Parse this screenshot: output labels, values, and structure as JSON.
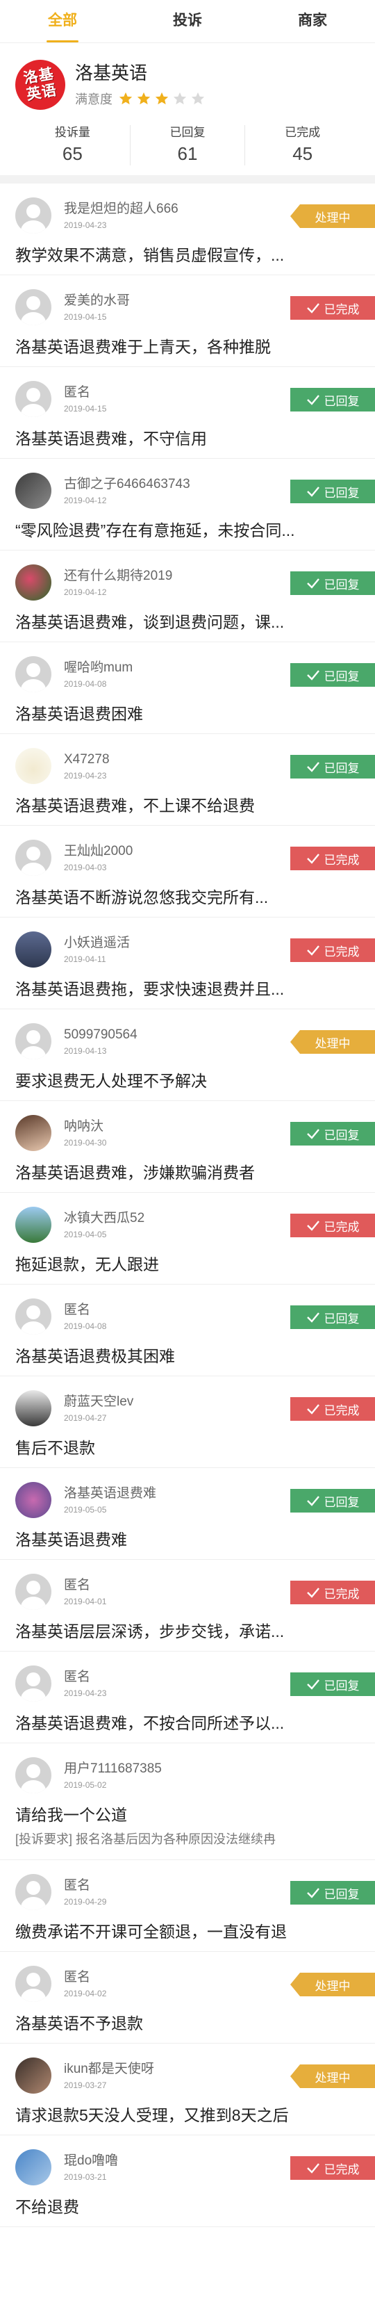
{
  "tabs": [
    {
      "label": "全部"
    },
    {
      "label": "投诉"
    },
    {
      "label": "商家"
    }
  ],
  "company": {
    "logo_line1": "洛基",
    "logo_line2": "英语",
    "name": "洛基英语",
    "rating_label": "满意度",
    "rating_value": 3,
    "rating_max": 5,
    "stats": [
      {
        "label": "投诉量",
        "value": "65"
      },
      {
        "label": "已回复",
        "value": "61"
      },
      {
        "label": "已完成",
        "value": "45"
      }
    ]
  },
  "colors": {
    "accent": "#f0b01c",
    "processing": "#e6ae3c",
    "done": "#e05a5a",
    "replied": "#4aa86a"
  },
  "complaints": [
    {
      "user": "我是炟炟的超人666",
      "date": "2019-04-23",
      "status": "处理中",
      "status_type": "processing",
      "title": "教学效果不满意，销售员虚假宣传，...",
      "avatar": "default"
    },
    {
      "user": "爱美的水哥",
      "date": "2019-04-15",
      "status": "已完成",
      "status_type": "done",
      "title": "洛基英语退费难于上青天，各种推脱",
      "avatar": "default"
    },
    {
      "user": "匿名",
      "date": "2019-04-15",
      "status": "已回复",
      "status_type": "replied",
      "title": "洛基英语退费难，不守信用",
      "avatar": "default"
    },
    {
      "user": "古御之子6466463743",
      "date": "2019-04-12",
      "status": "已回复",
      "status_type": "replied",
      "title": "“零风险退费”存在有意拖延，未按合同...",
      "avatar": "photo-a"
    },
    {
      "user": "还有什么期待2019",
      "date": "2019-04-12",
      "status": "已回复",
      "status_type": "replied",
      "title": "洛基英语退费难，谈到退费问题，课...",
      "avatar": "photo-b"
    },
    {
      "user": "喔哈哟mum",
      "date": "2019-04-08",
      "status": "已回复",
      "status_type": "replied",
      "title": "洛基英语退费困难",
      "avatar": "default"
    },
    {
      "user": "X47278",
      "date": "2019-04-23",
      "status": "已回复",
      "status_type": "replied",
      "title": "洛基英语退费难，不上课不给退费",
      "avatar": "photo-c"
    },
    {
      "user": "王灿灿2000",
      "date": "2019-04-03",
      "status": "已完成",
      "status_type": "done",
      "title": "洛基英语不断游说忽悠我交完所有...",
      "avatar": "default"
    },
    {
      "user": "小妖逍遥活",
      "date": "2019-04-11",
      "status": "已完成",
      "status_type": "done",
      "title": "洛基英语退费拖，要求快速退费并且...",
      "avatar": "photo-d"
    },
    {
      "user": "5099790564",
      "date": "2019-04-13",
      "status": "处理中",
      "status_type": "processing",
      "title": "要求退费无人处理不予解决",
      "avatar": "default"
    },
    {
      "user": "呐呐汏",
      "date": "2019-04-30",
      "status": "已回复",
      "status_type": "replied",
      "title": "洛基英语退费难，涉嫌欺骗消费者",
      "avatar": "photo-e"
    },
    {
      "user": "冰镇大西瓜52",
      "date": "2019-04-05",
      "status": "已完成",
      "status_type": "done",
      "title": "拖延退款，无人跟进",
      "avatar": "photo-f"
    },
    {
      "user": "匿名",
      "date": "2019-04-08",
      "status": "已回复",
      "status_type": "replied",
      "title": "洛基英语退费极其困难",
      "avatar": "default"
    },
    {
      "user": "蔚蓝天空lev",
      "date": "2019-04-27",
      "status": "已完成",
      "status_type": "done",
      "title": "售后不退款",
      "avatar": "photo-g"
    },
    {
      "user": "洛基英语退费难",
      "date": "2019-05-05",
      "status": "已回复",
      "status_type": "replied",
      "title": "洛基英语退费难",
      "avatar": "photo-h"
    },
    {
      "user": "匿名",
      "date": "2019-04-01",
      "status": "已完成",
      "status_type": "done",
      "title": "洛基英语层层深诱，步步交钱，承诺...",
      "avatar": "default"
    },
    {
      "user": "匿名",
      "date": "2019-04-23",
      "status": "已回复",
      "status_type": "replied",
      "title": "洛基英语退费难，不按合同所述予以...",
      "avatar": "default"
    },
    {
      "user": "用户7111687385",
      "date": "2019-05-02",
      "status": "",
      "status_type": "none",
      "title": "请给我一个公道",
      "sub": "[投诉要求] 报名洛基后因为各种原因没法继续冉",
      "avatar": "default"
    },
    {
      "user": "匿名",
      "date": "2019-04-29",
      "status": "已回复",
      "status_type": "replied",
      "title": "缴费承诺不开课可全额退，一直没有退",
      "avatar": "default"
    },
    {
      "user": "匿名",
      "date": "2019-04-02",
      "status": "处理中",
      "status_type": "processing",
      "title": "洛基英语不予退款",
      "avatar": "default"
    },
    {
      "user": "ikun都是天使呀",
      "date": "2019-03-27",
      "status": "处理中",
      "status_type": "processing",
      "title": "请求退款5天没人受理，又推到8天之后",
      "avatar": "photo-i"
    },
    {
      "user": "琨do噜噜",
      "date": "2019-03-21",
      "status": "已完成",
      "status_type": "done",
      "title": "不给退费",
      "avatar": "photo-j"
    }
  ]
}
